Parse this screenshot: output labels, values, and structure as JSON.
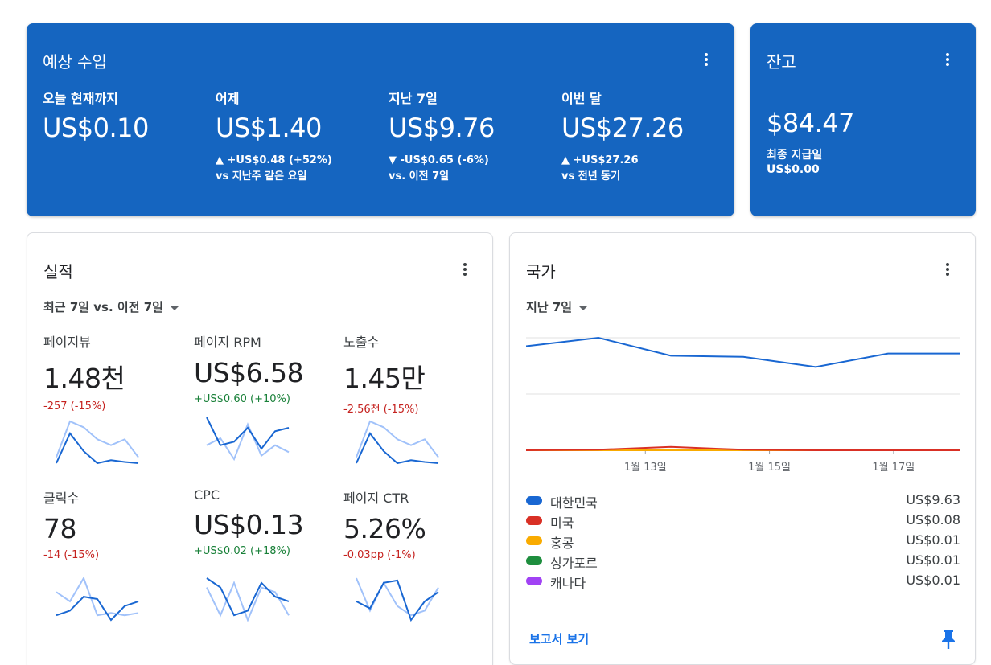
{
  "earnings": {
    "title": "예상 수입",
    "today": {
      "label": "오늘 현재까지",
      "value": "US$0.10"
    },
    "yesterday": {
      "label": "어제",
      "value": "US$1.40",
      "delta": "▲ +US$0.48 (+52%)",
      "compare": "vs 지난주 같은 요일"
    },
    "last7": {
      "label": "지난 7일",
      "value": "US$9.76",
      "delta": "▼ -US$0.65 (-6%)",
      "compare": "vs. 이전 7일"
    },
    "month": {
      "label": "이번 달",
      "value": "US$27.26",
      "delta": "▲ +US$27.26",
      "compare": "vs 전년 동기"
    }
  },
  "balance": {
    "title": "잔고",
    "value": "$84.47",
    "last_payment_label": "최종 지급일",
    "last_payment_value": "US$0.00"
  },
  "performance": {
    "title": "실적",
    "range": "최근 7일 vs. 이전 7일",
    "metrics": [
      {
        "label": "페이지뷰",
        "value": "1.48천",
        "delta": "-257 (-15%)",
        "trend": "negative",
        "current": [
          3,
          8,
          5,
          3,
          3.5,
          3.2,
          3
        ],
        "previous": [
          4,
          10,
          9,
          7,
          6,
          7,
          4
        ]
      },
      {
        "label": "페이지 RPM",
        "value": "US$6.58",
        "delta": "+US$0.60 (+10%)",
        "trend": "positive",
        "current": [
          9,
          5,
          5.5,
          7.5,
          4.5,
          7,
          7.5
        ],
        "previous": [
          5,
          6,
          3,
          8,
          3.5,
          5,
          4
        ]
      },
      {
        "label": "노출수",
        "value": "1.45만",
        "delta": "-2.56천 (-15%)",
        "trend": "negative",
        "current": [
          3,
          8,
          5,
          3,
          3.5,
          3.2,
          3
        ],
        "previous": [
          4,
          10,
          9,
          7,
          6,
          7,
          4
        ]
      },
      {
        "label": "클릭수",
        "value": "78",
        "delta": "-14 (-15%)",
        "trend": "negative",
        "current": [
          1,
          2,
          5,
          4.5,
          0,
          3,
          4
        ],
        "previous": [
          6,
          4,
          9,
          1,
          1.5,
          1,
          1.5
        ]
      },
      {
        "label": "CPC",
        "value": "US$0.13",
        "delta": "+US$0.02 (+18%)",
        "trend": "positive",
        "current": [
          9,
          7,
          1,
          2,
          8,
          5,
          4
        ],
        "previous": [
          7,
          1,
          8,
          0,
          7,
          6,
          1
        ]
      },
      {
        "label": "페이지 CTR",
        "value": "5.26%",
        "delta": "-0.03pp (-1%)",
        "trend": "negative",
        "current": [
          5,
          3.5,
          9,
          9.5,
          1,
          5,
          7
        ],
        "previous": [
          10,
          3,
          9,
          4,
          2,
          3,
          8
        ]
      }
    ],
    "colors": {
      "current": "#1967d2",
      "previous": "#a1c2fa"
    }
  },
  "countries": {
    "title": "국가",
    "range": "지난 7일",
    "report_link": "보고서 보기",
    "x_labels": [
      "1월 13일",
      "1월 15일",
      "1월 17일"
    ],
    "legend": [
      {
        "name": "대한민국",
        "value": "US$9.63",
        "color": "#1967d2"
      },
      {
        "name": "미국",
        "value": "US$0.08",
        "color": "#d93025"
      },
      {
        "name": "홍콩",
        "value": "US$0.01",
        "color": "#f9ab00"
      },
      {
        "name": "싱가포르",
        "value": "US$0.01",
        "color": "#1e8e3e"
      },
      {
        "name": "캐나다",
        "value": "US$0.01",
        "color": "#a142f4"
      }
    ]
  },
  "chart_data": {
    "type": "line",
    "x": [
      "1월 11일",
      "1월 12일",
      "1월 13일",
      "1월 14일",
      "1월 15일",
      "1월 16일",
      "1월 17일",
      "1월 18일"
    ],
    "x_ticks_shown": [
      "1월 13일",
      "1월 15일",
      "1월 17일"
    ],
    "series": [
      {
        "name": "대한민국",
        "values": [
          1.85,
          2.0,
          1.68,
          1.66,
          1.48,
          1.72,
          1.72
        ],
        "color": "#1967d2"
      },
      {
        "name": "미국",
        "values": [
          0.0,
          0.01,
          0.06,
          0.01,
          0.0,
          0.0,
          0.0
        ],
        "color": "#d93025"
      },
      {
        "name": "홍콩",
        "values": [
          0,
          0,
          0,
          0,
          0,
          0,
          0.01
        ],
        "color": "#f9ab00"
      },
      {
        "name": "싱가포르",
        "values": [
          0,
          0,
          0,
          0,
          0.01,
          0,
          0
        ],
        "color": "#1e8e3e"
      },
      {
        "name": "캐나다",
        "values": [
          0,
          0,
          0,
          0,
          0,
          0,
          0.01
        ],
        "color": "#a142f4"
      }
    ],
    "ylim": [
      0,
      2
    ],
    "grid": true
  }
}
